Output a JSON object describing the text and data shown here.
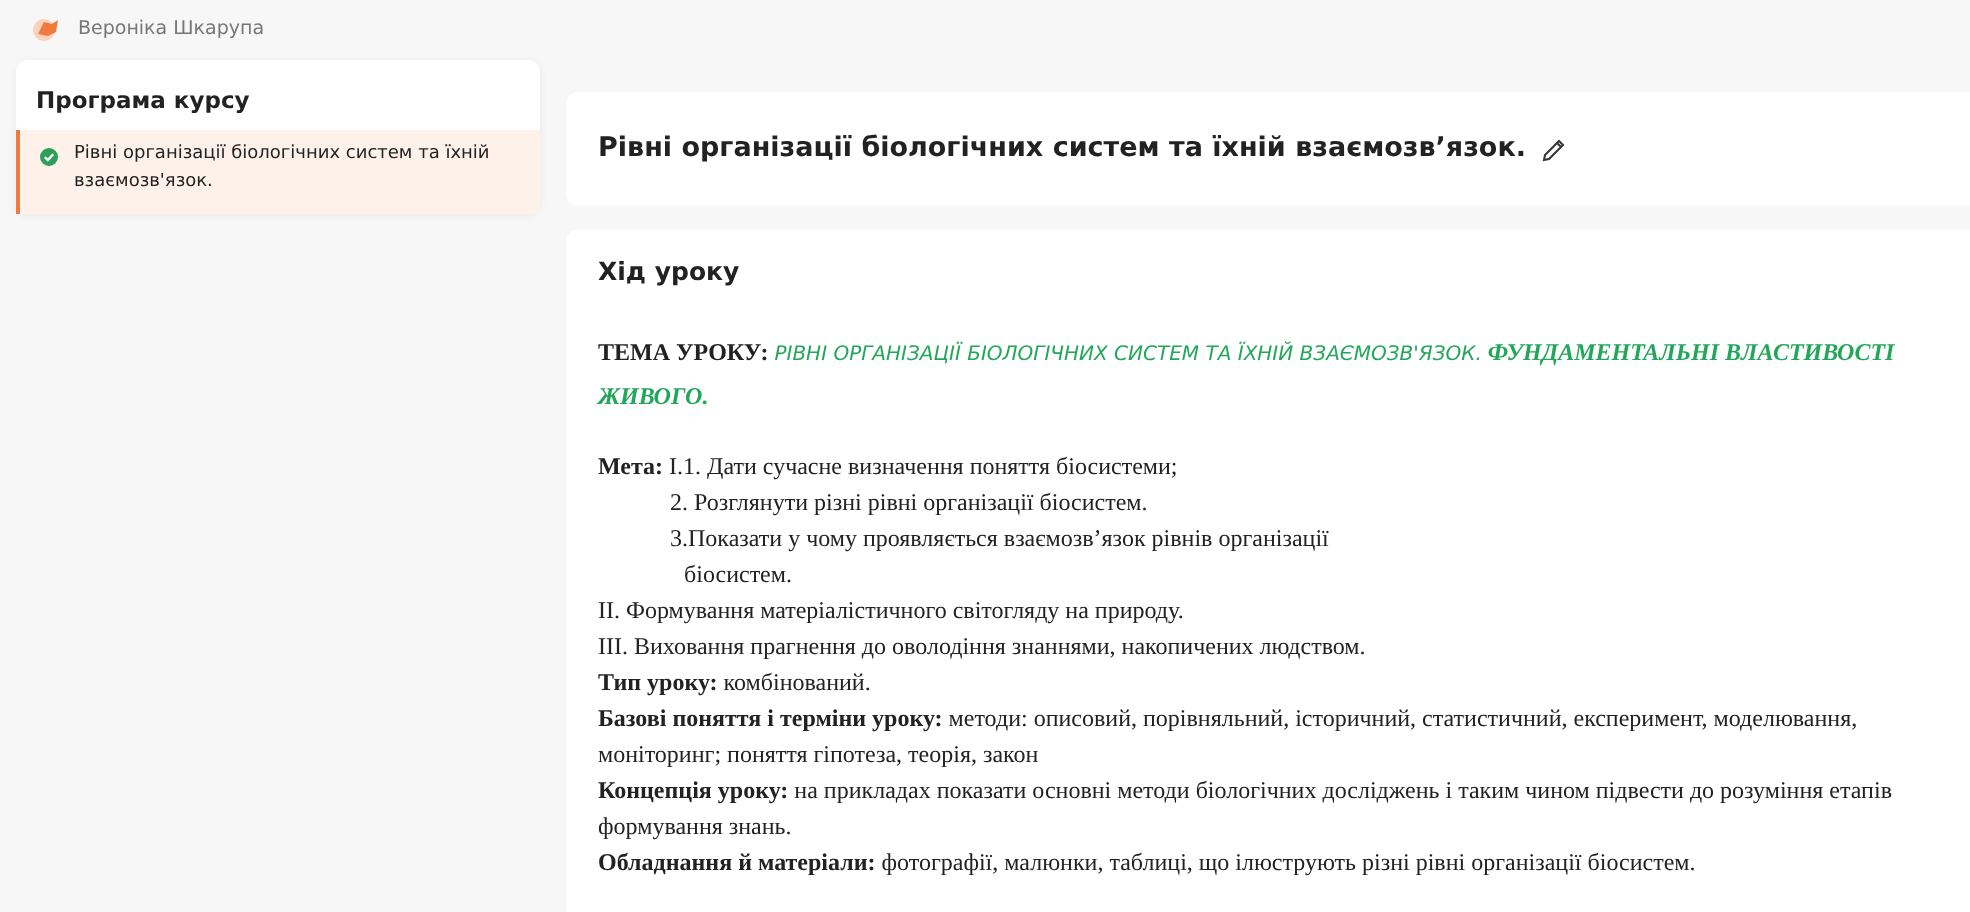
{
  "user": {
    "name": "Вероніка Шкарупа"
  },
  "sidebar": {
    "title": "Програма курсу",
    "items": [
      {
        "label": "Рівні організації біологічних систем та їхній взаємозв'язок.",
        "selected": true,
        "done": true
      }
    ]
  },
  "lesson": {
    "title": "Рівні організації біологічних систем та їхній взаємозв’язок."
  },
  "content": {
    "heading": "Хід уроку",
    "topic": {
      "label": "ТЕМА УРОКУ:",
      "text_1": "РІВНІ ОРГАНІЗАЦІЇ БІОЛОГІЧНИХ СИСТЕМ ТА ЇХНІЙ ВЗАЄМОЗВ'ЯЗОК.",
      "text_2": "ФУНДАМЕНТАЛЬНІ  ВЛАСТИВОСТІ ЖИВОГО."
    },
    "lines": [
      {
        "kind": "plain",
        "text": "**Мета:** I.1. Дати сучасне визначення поняття біосистеми;"
      },
      {
        "kind": "sub",
        "text": "2. Розглянути різні рівні організації біосистем."
      },
      {
        "kind": "sub",
        "text": "3.Показати у чому проявляється взаємозв’язок рівнів організації"
      },
      {
        "kind": "cont",
        "text": "біосистем."
      },
      {
        "kind": "plain",
        "text": "II. Формування матеріалістичного світогляду на природу."
      },
      {
        "kind": "plain",
        "text": "III. Виховання прагнення до оволодіння знаннями, накопичених людством."
      },
      {
        "kind": "plain",
        "text": "**Тип уроку:** комбінований."
      },
      {
        "kind": "plain",
        "text": "**Базові поняття і терміни уроку:** методи: описовий, порівняльний, історичний, статистичний, експеримент, моделювання, моніторинг; поняття гіпотеза, теорія, закон"
      },
      {
        "kind": "plain",
        "text": "**Концепція уроку:** на прикладах показати основні методи біологічних досліджень і таким чином підвести до розуміння етапів формування знань."
      },
      {
        "kind": "plain",
        "text": "**Обладнання й матеріали:** фотографії, малюнки, таблиці, що ілюструють різні рівні організації біосистем."
      }
    ]
  }
}
